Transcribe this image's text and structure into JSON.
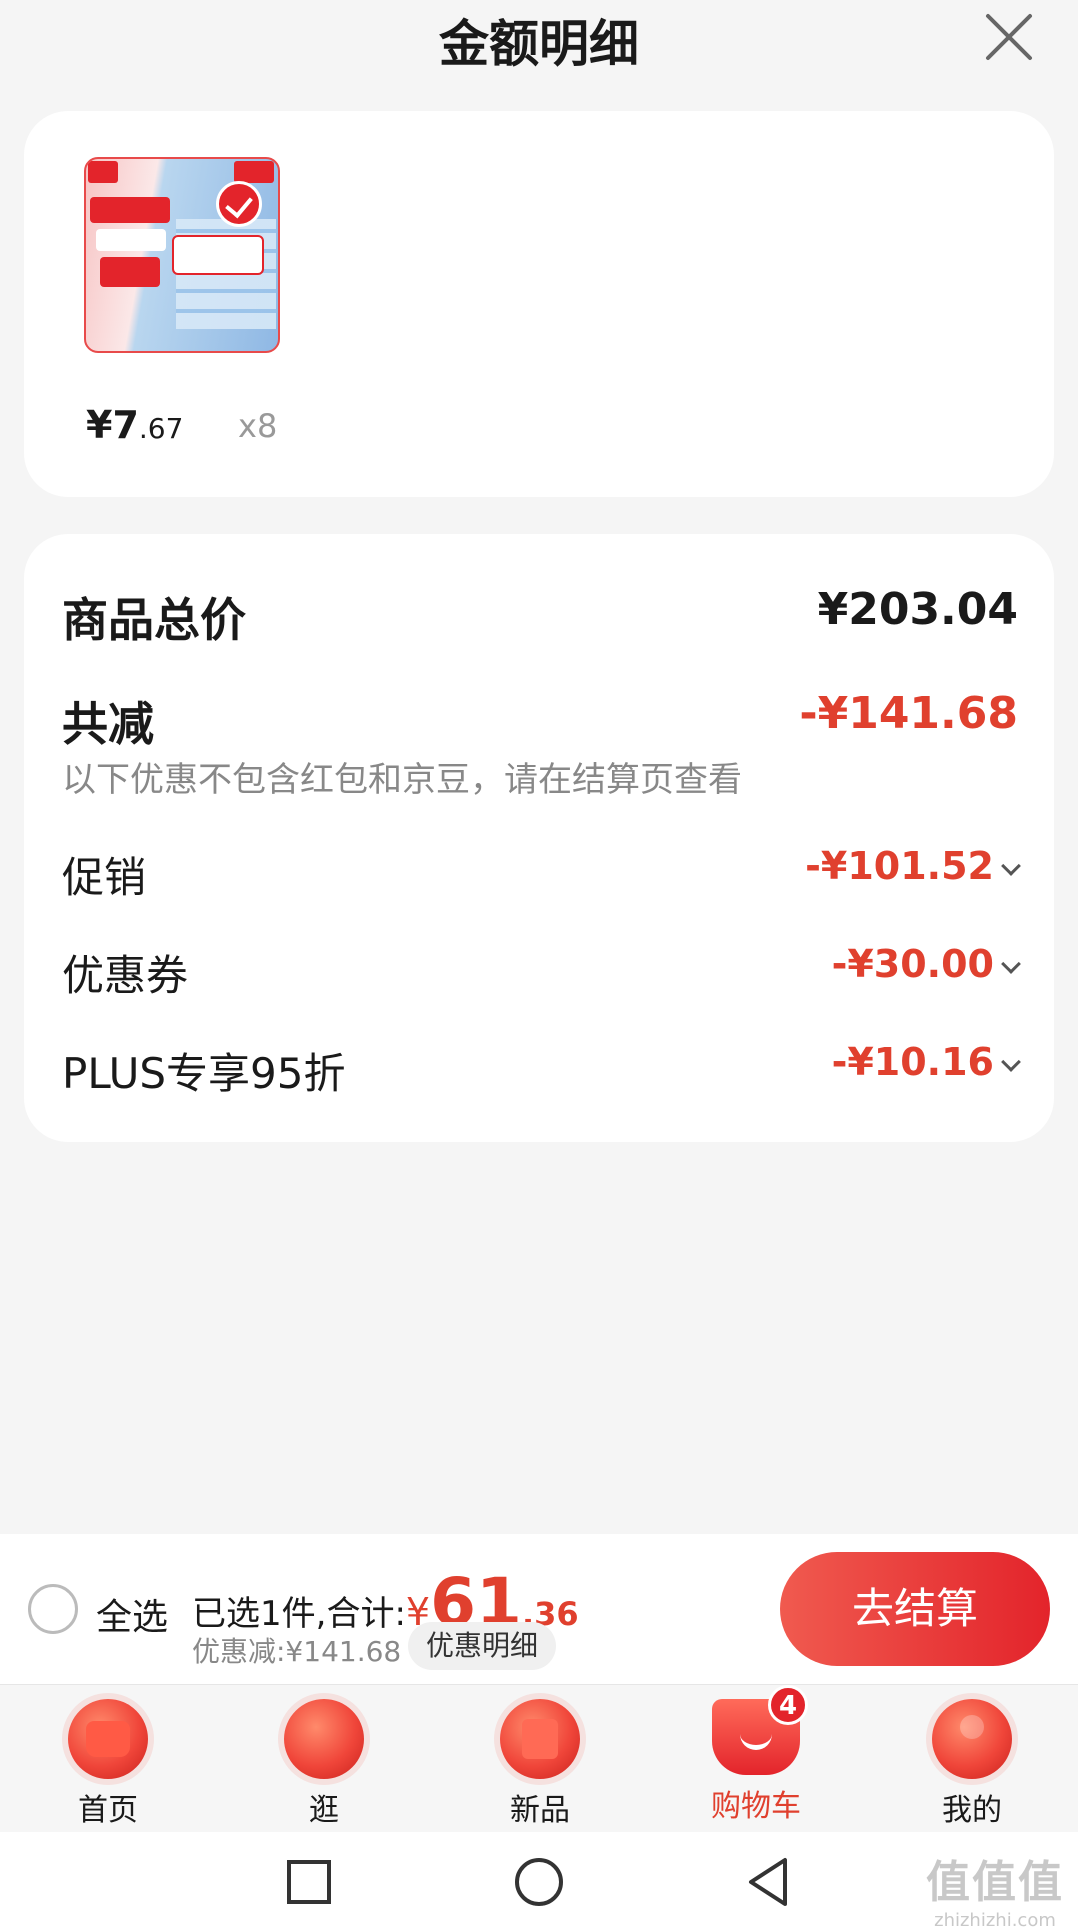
{
  "header": {
    "title": "金额明细"
  },
  "item": {
    "price_int": "¥7",
    "price_dec": ".67",
    "qty": "x8"
  },
  "summary_card": {
    "total_label": "商品总价",
    "total_value": "¥203.04",
    "reduce_label": "共减",
    "reduce_value": "-¥141.68",
    "hint": "以下优惠不包含红包和京豆，请在结算页查看",
    "discounts": [
      {
        "label": "促销",
        "value": "-¥101.52"
      },
      {
        "label": "优惠券",
        "value": "-¥30.00"
      },
      {
        "label": "PLUS专享95折",
        "value": "-¥10.16"
      }
    ]
  },
  "bottom": {
    "select_all": "全选",
    "selected_text": "已选1件,合计:",
    "currency": "¥",
    "amount_int": "61",
    "amount_dec": ".36",
    "saved": "优惠减:¥141.68",
    "detail_button": "优惠明细",
    "checkout": "去结算"
  },
  "tabs": [
    {
      "label": "首页",
      "icon": "home-icon"
    },
    {
      "label": "逛",
      "icon": "browse-icon"
    },
    {
      "label": "新品",
      "icon": "new-products-icon"
    },
    {
      "label": "购物车",
      "icon": "cart-icon",
      "active": true,
      "badge": "4"
    },
    {
      "label": "我的",
      "icon": "profile-icon"
    }
  ],
  "watermark": {
    "big": "值值值",
    "small": "zhizhizhi.com"
  },
  "colors": {
    "accent": "#e0402e",
    "checkout": "#e3242b",
    "background": "#f5f5f5"
  }
}
